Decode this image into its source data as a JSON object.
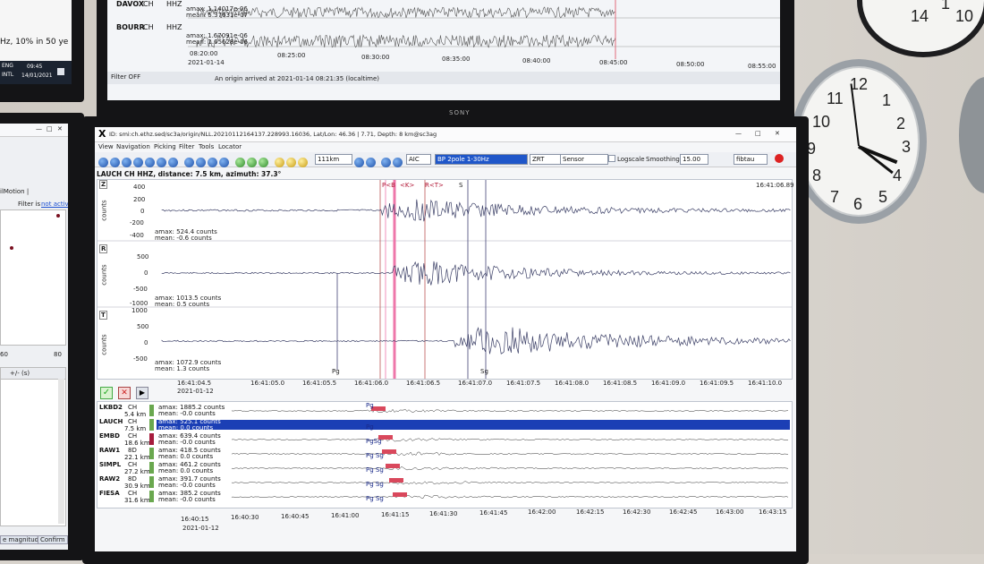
{
  "top_monitor": {
    "brand": "SONY",
    "stations": [
      {
        "name": "DAVOX",
        "net": "CH",
        "chan": "HHZ",
        "amax": "amax: 1.14017e-06",
        "mean": "mean: 5.37631e-07"
      },
      {
        "name": "BOURR",
        "net": "CH",
        "chan": "HHZ",
        "amax": "amax: 1.67091e-06",
        "mean": "mean: 1.05628e-06"
      }
    ],
    "time_ticks": [
      "08:20:00",
      "08:25:00",
      "08:30:00",
      "08:35:00",
      "08:40:00",
      "08:45:00",
      "08:50:00",
      "08:55:00"
    ],
    "date": "2021-01-14",
    "filter_status": "Filter OFF",
    "origin_message": "An origin arrived at 2021-01-14 08:21:35 (localtime)"
  },
  "left_monitor": {
    "ticker_text": "Hz, 10% in 50 ye",
    "lang1": "ENG",
    "lang2": "INTL",
    "clock_time": "09:45",
    "clock_date": "14/01/2021",
    "panel_title": "ilMotion |",
    "filter_text": "Filter is",
    "filter_link": "not active",
    "axis_60": "60",
    "axis_80": "80",
    "col_header": "+/- (s)",
    "btn_magnitudes": "e magnitudes",
    "btn_confirm": "Confirm"
  },
  "main": {
    "window_title": "ID: smi:ch.ethz.sed/sc3a/origin/NLL.20210112164137.228993.16036, Lat/Lon: 46.36 | 7.71, Depth: 8 km@sc3ag",
    "menu": [
      "View",
      "Navigation",
      "Picking",
      "Filter",
      "Tools",
      "Locator"
    ],
    "toolbar": {
      "distance": "111km",
      "mode": "AIC",
      "filter": "BP 2pole 1-30Hz",
      "rotation": "ZRT",
      "unit": "Sensor",
      "logscale": "Logscale",
      "smoothing": "Smoothing",
      "smoothing_value": "15.00",
      "locator": "fibtau"
    },
    "station_header": "LAUCH  CH  HHZ, distance: 7.5 km, azimuth: 37.3°",
    "time_corner": "16:41:06.89",
    "traces": [
      {
        "comp": "Z",
        "yticks": [
          "400",
          "200",
          "0",
          "-200",
          "-400"
        ],
        "amax": "amax: 524.4 counts",
        "mean": "mean: -0.6 counts",
        "picks": [
          "P<B",
          "<K>",
          "R<T>",
          "S"
        ]
      },
      {
        "comp": "R",
        "yticks": [
          "500",
          "0",
          "-500",
          "-1000"
        ],
        "amax": "amax: 1013.5 counts",
        "mean": "mean: 0.5 counts",
        "picks": []
      },
      {
        "comp": "T",
        "yticks": [
          "1000",
          "500",
          "0",
          "-500"
        ],
        "amax": "amax: 1072.9 counts",
        "mean": "mean: 1.3 counts",
        "picks": [
          "Pg",
          "Sg"
        ]
      }
    ],
    "ylabel": "counts",
    "time_ticks": [
      "16:41:04.5",
      "16:41:05.0",
      "16:41:05.5",
      "16:41:06.0",
      "16:41:06.5",
      "16:41:07.0",
      "16:41:07.5",
      "16:41:08.0",
      "16:41:08.5",
      "16:41:09.0",
      "16:41:09.5",
      "16:41:10.0"
    ],
    "date": "2021-01-12",
    "overview": {
      "stations": [
        {
          "name": "LKBD2",
          "net": "CH",
          "dist": "5.4 km",
          "amax": "amax: 1885.2 counts",
          "mean": "mean: -0.0 counts",
          "pick": "Pg",
          "color": "#6aa84f"
        },
        {
          "name": "LAUCH",
          "net": "CH",
          "dist": "7.5 km",
          "amax": "amax: 525.1 counts",
          "mean": "mean: 0.0 counts",
          "pick": "Pg",
          "color": "#6aa84f",
          "selected": true
        },
        {
          "name": "EMBD",
          "net": "CH",
          "dist": "18.6 km",
          "amax": "amax: 639.4 counts",
          "mean": "mean: -0.0 counts",
          "pick": "PgSg",
          "color": "#a61c3c"
        },
        {
          "name": "RAW1",
          "net": "8D",
          "dist": "22.1 km",
          "amax": "amax: 418.5 counts",
          "mean": "mean: 0.0 counts",
          "pick": "Pg Sg",
          "color": "#6aa84f"
        },
        {
          "name": "SIMPL",
          "net": "CH",
          "dist": "27.2 km",
          "amax": "amax: 461.2 counts",
          "mean": "mean: 0.0 counts",
          "pick": "Pg Sg",
          "color": "#6aa84f"
        },
        {
          "name": "RAW2",
          "net": "8D",
          "dist": "30.9 km",
          "amax": "amax: 391.7 counts",
          "mean": "mean: -0.0 counts",
          "pick": "Pg Sg",
          "color": "#6aa84f"
        },
        {
          "name": "FIESA",
          "net": "CH",
          "dist": "31.6 km",
          "amax": "amax: 385.2 counts",
          "mean": "mean: -0.0 counts",
          "pick": "Pg Sg",
          "color": "#6aa84f"
        }
      ],
      "time_ticks": [
        "16:40:15",
        "16:40:30",
        "16:40:45",
        "16:41:00",
        "16:41:15",
        "16:41:30",
        "16:41:45",
        "16:42:00",
        "16:42:15",
        "16:42:30",
        "16:42:45",
        "16:43:00",
        "16:43:15"
      ],
      "date": "2021-01-12"
    }
  },
  "clocks": [
    {
      "numbers": [
        "12",
        "1",
        "2",
        "3",
        "4",
        "5",
        "6",
        "7",
        "8",
        "9",
        "10",
        "11"
      ]
    },
    {
      "numbers": [
        "14",
        "1",
        "10"
      ]
    }
  ]
}
